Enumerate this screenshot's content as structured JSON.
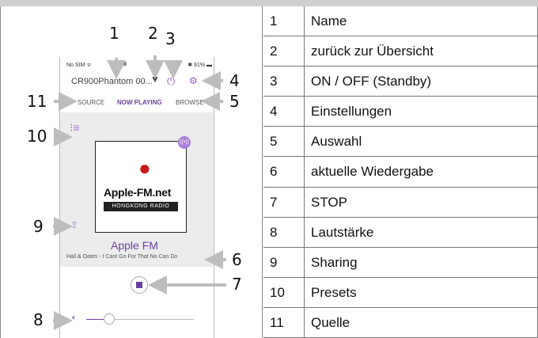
{
  "phone": {
    "status_left": "No SIM ᯤ",
    "status_time": "09:28",
    "status_right": "✱ 91% ▬",
    "device_name": "CR900Phantom 00...",
    "tabs": {
      "source": "SOURCE",
      "now_playing": "NOW PLAYING",
      "browse": "BROWSE"
    },
    "cover_brand": "Apple-FM.net",
    "cover_sub": "HONGKONG RADIO",
    "station_name": "Apple FM",
    "track_info": "Hall & Oates - I Cant Go For That No Can Do",
    "badge": "((•))"
  },
  "callouts": [
    "1",
    "2",
    "3",
    "4",
    "5",
    "6",
    "7",
    "8",
    "9",
    "10",
    "11"
  ],
  "legend": [
    {
      "num": "1",
      "label": "Name"
    },
    {
      "num": "2",
      "label": "zurück zur Übersicht"
    },
    {
      "num": "3",
      "label": "ON / OFF (Standby)"
    },
    {
      "num": "4",
      "label": "Einstellungen"
    },
    {
      "num": "5",
      "label": "Auswahl"
    },
    {
      "num": "6",
      "label": "aktuelle Wiedergabe"
    },
    {
      "num": "7",
      "label": "STOP"
    },
    {
      "num": "8",
      "label": "Lautstärke"
    },
    {
      "num": "9",
      "label": "Sharing"
    },
    {
      "num": "10",
      "label": "Presets"
    },
    {
      "num": "11",
      "label": "Quelle"
    }
  ],
  "colors": {
    "accent": "#6b3fa0",
    "arrow": "#bdbdbd",
    "header": "#cfcfcf"
  }
}
